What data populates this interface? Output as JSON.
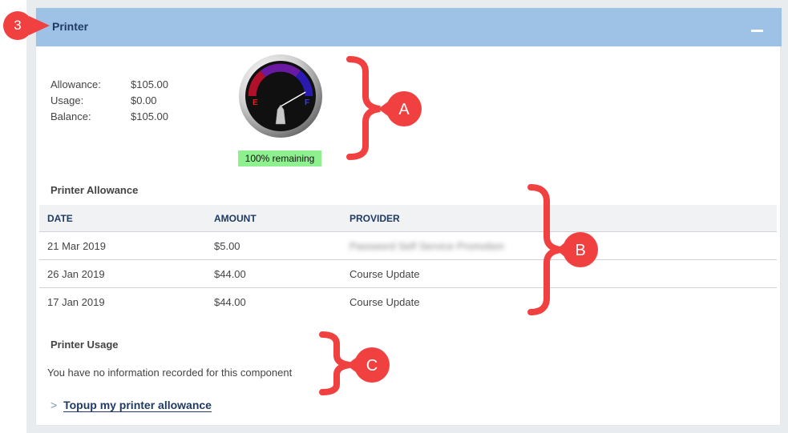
{
  "panel": {
    "title": "Printer",
    "collapse_icon": "minus-icon"
  },
  "summary": [
    {
      "label": "Allowance:",
      "value": "$105.00"
    },
    {
      "label": "Usage:",
      "value": "$0.00"
    },
    {
      "label": "Balance:",
      "value": "$105.00"
    }
  ],
  "gauge": {
    "remaining_fraction": 1.0,
    "empty_label": "E",
    "full_label": "F",
    "status_text": "100% remaining"
  },
  "allowance": {
    "title": "Printer Allowance",
    "columns": [
      "DATE",
      "AMOUNT",
      "PROVIDER"
    ],
    "rows": [
      {
        "date": "21 Mar 2019",
        "amount": "$5.00",
        "provider": "Password Self Service Promotion",
        "provider_blurred": true
      },
      {
        "date": "26 Jan 2019",
        "amount": "$44.00",
        "provider": "Course Update"
      },
      {
        "date": "17 Jan 2019",
        "amount": "$44.00",
        "provider": "Course Update"
      }
    ]
  },
  "usage": {
    "title": "Printer Usage",
    "empty_message": "You have no information recorded for this component"
  },
  "topup": {
    "chevron": ">",
    "label": "Topup my printer allowance"
  },
  "annotations": {
    "step_marker": "3",
    "brace_a": "A",
    "brace_b": "B",
    "brace_c": "C"
  },
  "colors": {
    "header": "#9ec1e6",
    "title_text": "#1f3b63",
    "annotation": "#f04040",
    "gauge_status": "#8ef08e"
  }
}
